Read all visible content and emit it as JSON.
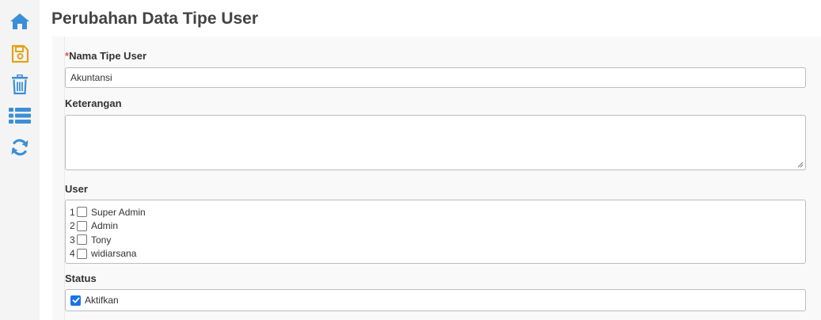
{
  "sidebar": {
    "items": [
      {
        "name": "home",
        "icon": "home-icon",
        "color": "#3b8fd6"
      },
      {
        "name": "save",
        "icon": "save-icon",
        "color": "#e2a21b"
      },
      {
        "name": "delete",
        "icon": "trash-icon",
        "color": "#3b8fd6"
      },
      {
        "name": "list",
        "icon": "list-icon",
        "color": "#3b8fd6"
      },
      {
        "name": "refresh",
        "icon": "refresh-icon",
        "color": "#3b8fd6"
      }
    ]
  },
  "page": {
    "title": "Perubahan Data Tipe User"
  },
  "form": {
    "nama_tipe_user": {
      "required_mark": "*",
      "label": "Nama Tipe User",
      "value": "Akuntansi"
    },
    "keterangan": {
      "label": "Keterangan",
      "value": ""
    },
    "user": {
      "label": "User",
      "items": [
        {
          "num": "1",
          "name": "Super Admin",
          "checked": false
        },
        {
          "num": "2",
          "name": "Admin",
          "checked": false
        },
        {
          "num": "3",
          "name": "Tony",
          "checked": false
        },
        {
          "num": "4",
          "name": "widiarsana",
          "checked": false
        }
      ]
    },
    "status": {
      "label": "Status",
      "option_label": "Aktifkan",
      "checked": true
    }
  },
  "colors": {
    "required": "#d9534f",
    "checkbox_checked": "#1a73e8",
    "icon_blue": "#3b8fd6",
    "icon_orange": "#e2a21b"
  }
}
